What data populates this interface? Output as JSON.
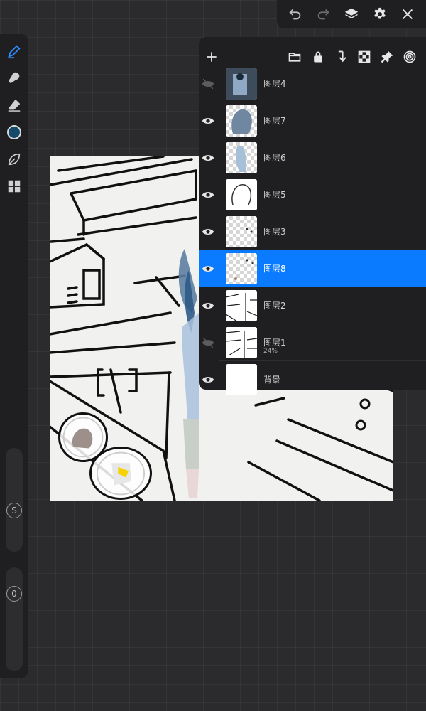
{
  "top_bar": {
    "icons": [
      "undo-icon",
      "redo-icon",
      "layers-icon",
      "settings-icon",
      "close-icon"
    ]
  },
  "left_toolbar": {
    "tools": [
      "brush-icon",
      "smudge-icon",
      "eraser-icon",
      "color-swatch",
      "leaf-icon",
      "tiles-icon"
    ],
    "color": "#154a6b",
    "size_label": "S",
    "opacity_label": "0"
  },
  "layers_panel": {
    "toolbar_icons": [
      "add-layer-icon",
      "folder-icon",
      "lock-icon",
      "merge-down-icon",
      "checker-icon",
      "pin-icon",
      "spiral-icon"
    ],
    "layers": [
      {
        "name": "图层4",
        "visible": false,
        "selected": false,
        "opacity_label": ""
      },
      {
        "name": "图层7",
        "visible": true,
        "selected": false,
        "opacity_label": ""
      },
      {
        "name": "图层6",
        "visible": true,
        "selected": false,
        "opacity_label": ""
      },
      {
        "name": "图层5",
        "visible": true,
        "selected": false,
        "opacity_label": ""
      },
      {
        "name": "图层3",
        "visible": true,
        "selected": false,
        "opacity_label": ""
      },
      {
        "name": "图层8",
        "visible": true,
        "selected": true,
        "opacity_label": ""
      },
      {
        "name": "图层2",
        "visible": true,
        "selected": false,
        "opacity_label": ""
      },
      {
        "name": "图层1",
        "visible": false,
        "selected": false,
        "opacity_label": "24%"
      },
      {
        "name": "背景",
        "visible": true,
        "selected": false,
        "opacity_label": ""
      }
    ]
  },
  "colors": {
    "accent": "#0a7bff",
    "panel": "#1f1f21",
    "background": "#2b2b2d"
  }
}
